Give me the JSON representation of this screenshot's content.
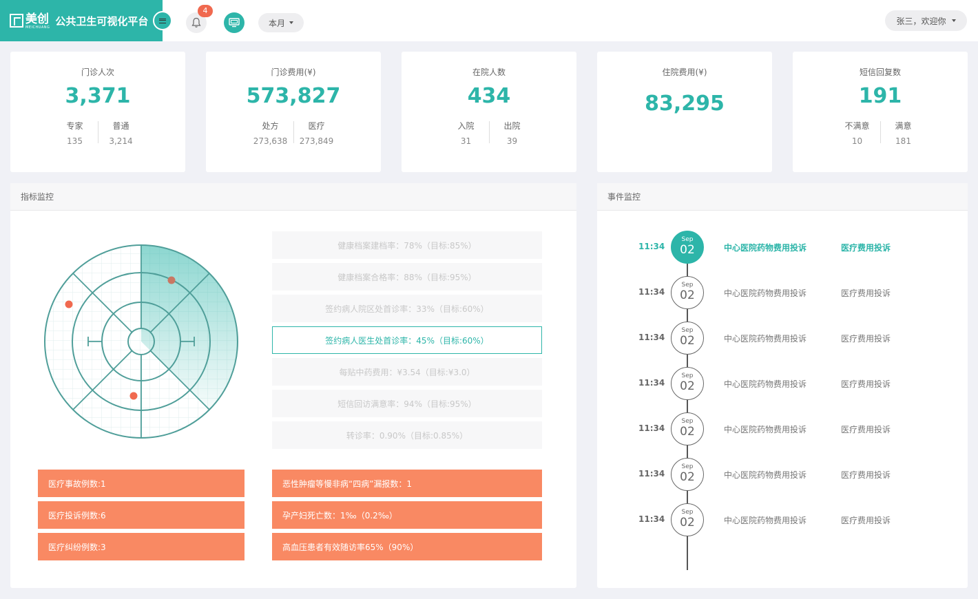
{
  "header": {
    "logo_text": "美创",
    "logo_sub": "MEICHUANG",
    "title": "公共卫生可视化平台",
    "notification_count": "4",
    "period": "本月",
    "user_greeting": "张三，欢迎你"
  },
  "stats": [
    {
      "title": "门诊人次",
      "value": "3,371",
      "a_label": "专家",
      "a_value": "135",
      "b_label": "普通",
      "b_value": "3,214"
    },
    {
      "title": "门诊费用(¥)",
      "value": "573,827",
      "a_label": "处方",
      "a_value": "273,638",
      "b_label": "医疗",
      "b_value": "273,849"
    },
    {
      "title": "在院人数",
      "value": "434",
      "a_label": "入院",
      "a_value": "31",
      "b_label": "出院",
      "b_value": "39"
    },
    {
      "title": "住院费用(¥)",
      "value": "83,295"
    },
    {
      "title": "短信回复数",
      "value": "191",
      "a_label": "不满意",
      "a_value": "10",
      "b_label": "满意",
      "b_value": "181"
    }
  ],
  "indicator_panel": {
    "title": "指标监控",
    "metrics": [
      "健康档案建档率：78%（目标:85%）",
      "健康档案合格率：88%（目标:95%）",
      "签约病人院区处首诊率：33%（目标:60%）",
      "签约病人医生处首诊率：45%（目标:60%）",
      "每贴中药费用：¥3.54（目标:¥3.0）",
      "短信回访满意率：94%（目标:95%）",
      "转诊率：0.90%（目标:0.85%）"
    ],
    "active_metric_index": 3,
    "alerts_left": [
      "医疗事故例数:1",
      "医疗投诉例数:6",
      "医疗纠纷例数:3"
    ],
    "alerts_right": [
      "恶性肿瘤等慢非病“四病”漏报数：1",
      "孕产妇死亡数：1‰（0.2‰）",
      "高血压患者有效随访率65%（90%）"
    ]
  },
  "event_panel": {
    "title": "事件监控",
    "events": [
      {
        "time": "11:34",
        "month": "Sep",
        "day": "02",
        "event": "中心医院药物费用投诉",
        "type": "医疗费用投诉"
      },
      {
        "time": "11:34",
        "month": "Sep",
        "day": "02",
        "event": "中心医院药物费用投诉",
        "type": "医疗费用投诉"
      },
      {
        "time": "11:34",
        "month": "Sep",
        "day": "02",
        "event": "中心医院药物费用投诉",
        "type": "医疗费用投诉"
      },
      {
        "time": "11:34",
        "month": "Sep",
        "day": "02",
        "event": "中心医院药物费用投诉",
        "type": "医疗费用投诉"
      },
      {
        "time": "11:34",
        "month": "Sep",
        "day": "02",
        "event": "中心医院药物费用投诉",
        "type": "医疗费用投诉"
      },
      {
        "time": "11:34",
        "month": "Sep",
        "day": "02",
        "event": "中心医院药物费用投诉",
        "type": "医疗费用投诉"
      },
      {
        "time": "11:34",
        "month": "Sep",
        "day": "02",
        "event": "中心医院药物费用投诉",
        "type": "医疗费用投诉"
      }
    ]
  },
  "colors": {
    "accent": "#2db5a9",
    "alert": "#f98963",
    "badge": "#f0694f",
    "radar_dot": "#f0694f"
  }
}
